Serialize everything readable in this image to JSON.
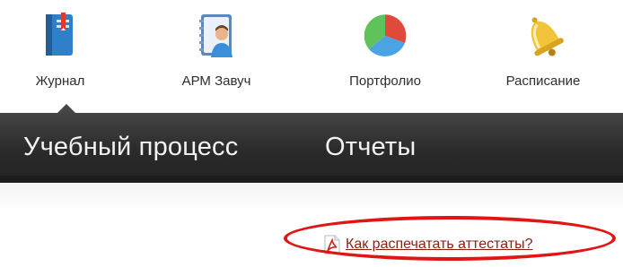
{
  "top_nav": {
    "items": [
      {
        "label": "Журнал",
        "icon": "journal-book-icon"
      },
      {
        "label": "АРМ Завуч",
        "icon": "teacher-notebook-icon"
      },
      {
        "label": "Портфолио",
        "icon": "pie-chart-icon"
      },
      {
        "label": "Расписание",
        "icon": "bell-icon"
      }
    ],
    "active_index": 0
  },
  "tabs": [
    {
      "label": "Учебный процесс"
    },
    {
      "label": "Отчеты"
    }
  ],
  "content": {
    "help_link": {
      "label": "Как распечатать аттестаты?",
      "icon": "pdf-icon"
    }
  },
  "colors": {
    "tabbar_bg": "#2a2a2a",
    "link": "#8a1f12",
    "highlight": "#e21414"
  }
}
